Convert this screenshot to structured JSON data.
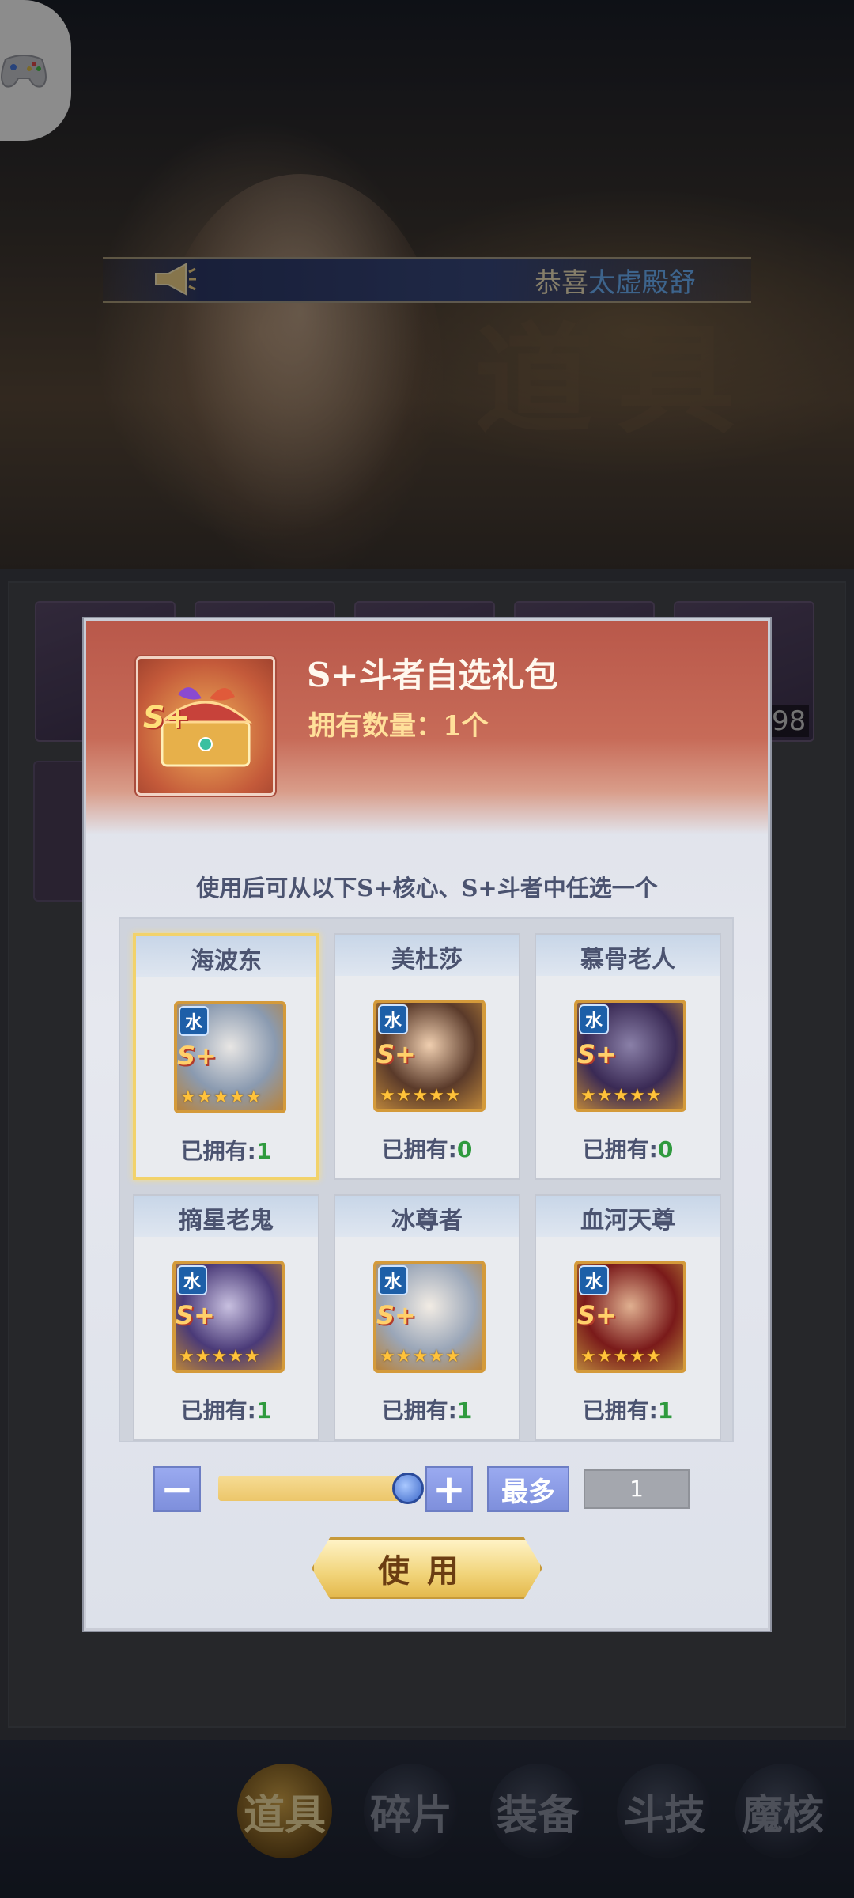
{
  "banner": {
    "prefix": "恭喜",
    "highlight": "太虚殿舒"
  },
  "background": {
    "watermark": "道具",
    "count_badge": "98"
  },
  "item": {
    "title": "S+斗者自选礼包",
    "owned_label": "拥有数量：",
    "owned_value": "1个",
    "icon_text": "S+"
  },
  "description": "使用后可从以下S+核心、S+斗者中任选一个",
  "options": [
    {
      "name": "海波东",
      "element": "水",
      "rank": "S+",
      "owned_label": "已拥有:",
      "owned": "1",
      "selected": true
    },
    {
      "name": "美杜莎",
      "element": "水",
      "rank": "S+",
      "owned_label": "已拥有:",
      "owned": "0",
      "selected": false
    },
    {
      "name": "慕骨老人",
      "element": "水",
      "rank": "S+",
      "owned_label": "已拥有:",
      "owned": "0",
      "selected": false
    },
    {
      "name": "摘星老鬼",
      "element": "水",
      "rank": "S+",
      "owned_label": "已拥有:",
      "owned": "1",
      "selected": false
    },
    {
      "name": "冰尊者",
      "element": "水",
      "rank": "S+",
      "owned_label": "已拥有:",
      "owned": "1",
      "selected": false
    },
    {
      "name": "血河天尊",
      "element": "水",
      "rank": "S+",
      "owned_label": "已拥有:",
      "owned": "1",
      "selected": false
    }
  ],
  "stepper": {
    "minus": "−",
    "plus": "+",
    "max_label": "最多",
    "quantity": "1",
    "slider_level": 1.0
  },
  "use_button": "使用",
  "tabs": [
    {
      "label": "道具",
      "active": true
    },
    {
      "label": "碎片",
      "active": false
    },
    {
      "label": "装备",
      "active": false
    },
    {
      "label": "斗技",
      "active": false
    },
    {
      "label": "魔核",
      "active": false
    }
  ],
  "colors": {
    "header_red": "#c76b58",
    "accent_blue": "#7e8fdc",
    "owned_green": "#2f9a3e",
    "gold": "#f1d47a"
  }
}
